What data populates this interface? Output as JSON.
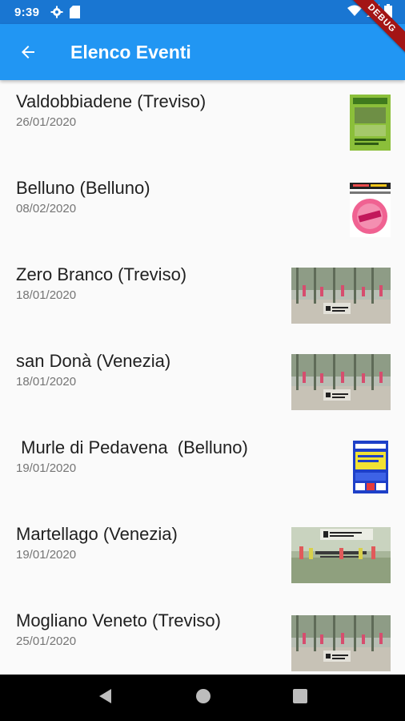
{
  "status_bar": {
    "time": "9:39",
    "icons": [
      "gear-icon",
      "sd-card-icon",
      "wifi-icon",
      "signal-icon",
      "battery-icon"
    ],
    "background": "#1976d2"
  },
  "debug_banner": {
    "label": "DEBUG",
    "color": "#a31515"
  },
  "app_bar": {
    "title": "Elenco Eventi",
    "back_icon": "arrow-back-icon",
    "background": "#2196f3"
  },
  "events": [
    {
      "place": "Valdobbiadene (Treviso)",
      "date": "26/01/2020",
      "thumbnail": "green-flyer"
    },
    {
      "place": "Belluno (Belluno)",
      "date": "08/02/2020",
      "thumbnail": "pink-badge-flyer"
    },
    {
      "place": "Zero Branco (Treviso)",
      "date": "18/01/2020",
      "thumbnail": "nordic-workout-photo"
    },
    {
      "place": "san Donà (Venezia)",
      "date": "18/01/2020",
      "thumbnail": "nordic-workout-photo"
    },
    {
      "place": " Murle di Pedavena  (Belluno)",
      "date": "19/01/2020",
      "thumbnail": "blue-yellow-flyer"
    },
    {
      "place": "Martellago (Venezia)",
      "date": "19/01/2020",
      "thumbnail": "martellago-photo"
    },
    {
      "place": "Mogliano Veneto (Treviso)",
      "date": "25/01/2020",
      "thumbnail": "nordic-workout-photo"
    }
  ],
  "nav_bar": {
    "icons": [
      "back-triangle-icon",
      "home-circle-icon",
      "recents-square-icon"
    ]
  }
}
